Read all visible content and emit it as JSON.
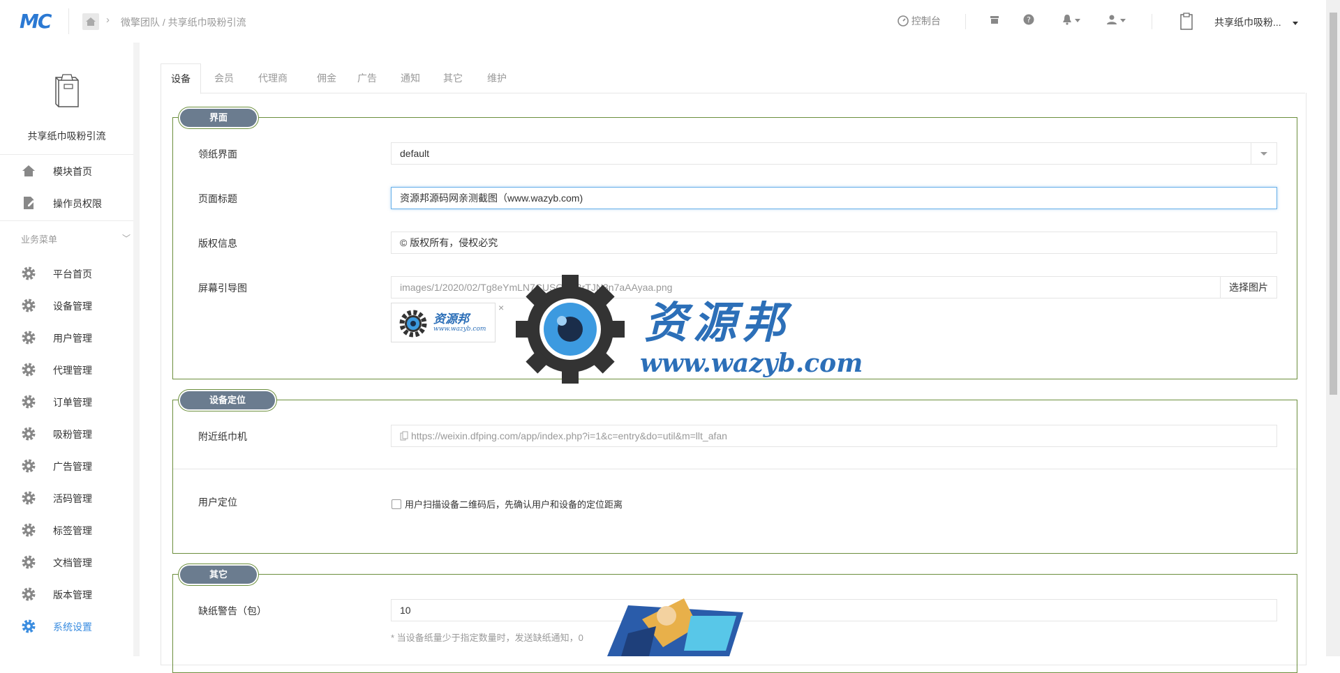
{
  "header": {
    "logo": "MC",
    "breadcrumb": [
      "微擎团队",
      "共享纸巾吸粉引流"
    ],
    "breadcrumb_sep": "/",
    "console_label": "控制台",
    "account_name": "共享纸巾吸粉..."
  },
  "sidebar": {
    "module_name": "共享纸巾吸粉引流",
    "top_items": [
      {
        "label": "模块首页",
        "icon": "home-icon"
      },
      {
        "label": "操作员权限",
        "icon": "edit-icon"
      }
    ],
    "group_title": "业务菜单",
    "items": [
      {
        "label": "平台首页",
        "icon": "gear-icon"
      },
      {
        "label": "设备管理",
        "icon": "gear-icon"
      },
      {
        "label": "用户管理",
        "icon": "gear-icon"
      },
      {
        "label": "代理管理",
        "icon": "gear-icon"
      },
      {
        "label": "订单管理",
        "icon": "gear-icon"
      },
      {
        "label": "吸粉管理",
        "icon": "gear-icon"
      },
      {
        "label": "广告管理",
        "icon": "gear-icon"
      },
      {
        "label": "活码管理",
        "icon": "gear-icon"
      },
      {
        "label": "标签管理",
        "icon": "gear-icon"
      },
      {
        "label": "文档管理",
        "icon": "gear-icon"
      },
      {
        "label": "版本管理",
        "icon": "gear-icon"
      },
      {
        "label": "系统设置",
        "icon": "gear-icon",
        "active": true
      }
    ]
  },
  "tabs": [
    "设备",
    "会员",
    "代理商",
    "佣金",
    "广告",
    "通知",
    "其它",
    "维护"
  ],
  "sections": {
    "ui": {
      "legend": "界面",
      "paper_ui_label": "领纸界面",
      "paper_ui_value": "default",
      "page_title_label": "页面标题",
      "page_title_value": "资源邦源码网亲测截图（www.wazyb.com)",
      "copyright_label": "版权信息",
      "copyright_value": "© 版权所有，侵权必究",
      "screen_guide_label": "屏幕引导图",
      "screen_guide_value": "images/1/2020/02/Tg8eYmLN7CUSGSbBrTJN3n7aAAyaa.png",
      "pick_image_label": "选择图片",
      "thumb_remove": "×"
    },
    "location": {
      "legend": "设备定位",
      "nearby_label": "附近纸巾机",
      "nearby_url": "https://weixin.dfping.com/app/index.php?i=1&c=entry&do=util&m=llt_afan",
      "user_loc_label": "用户定位",
      "user_loc_checkbox": "用户扫描设备二维码后，先确认用户和设备的定位距离"
    },
    "other": {
      "legend": "其它",
      "shortage_label": "缺纸警告（包）",
      "shortage_value": "10",
      "shortage_help": "* 当设备纸量少于指定数量时，发送缺纸通知，0"
    }
  },
  "watermark": {
    "cn": "资源邦",
    "url": "www.wazyb.com",
    "thumb_cn": "资源邦",
    "thumb_url": "www.wazyb.com"
  },
  "colors": {
    "accent": "#3b8de0",
    "legend_bg": "#6b7c8f",
    "fieldset_border": "#6b8e3c",
    "watermark": "#2c6fb8"
  }
}
